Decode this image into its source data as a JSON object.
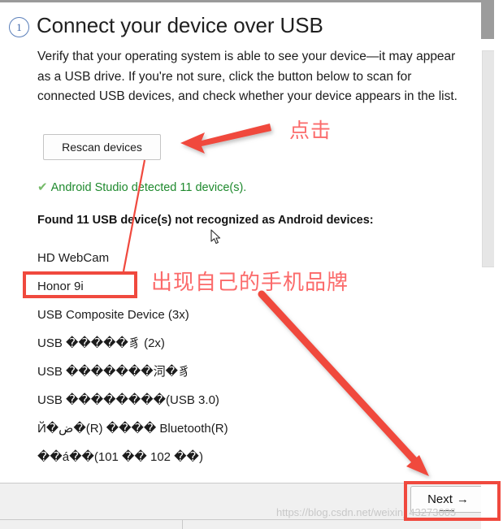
{
  "window": {
    "scrollbar_present": true
  },
  "header": {
    "step_number": "1",
    "title": "Connect your device over USB"
  },
  "body": {
    "description": "Verify that your operating system is able to see your device—it may appear as a USB drive. If you're not sure, click the button below to scan for connected USB devices, and check whether your device appears in the list."
  },
  "actions": {
    "rescan_label": "Rescan devices",
    "next_label": "Next",
    "next_arrow": "→"
  },
  "status": {
    "check_icon": "✔",
    "detected_message": "Android Studio detected 11 device(s).",
    "detected_color": "#1f8a2e",
    "found_heading": "Found 11 USB device(s) not recognized as Android devices:"
  },
  "devices": [
    {
      "label": "HD WebCam"
    },
    {
      "label": "Honor 9i"
    },
    {
      "label": "USB Composite Device (3x)"
    },
    {
      "label": "USB �����豸 (2x)"
    },
    {
      "label": "USB �������泀�豸"
    },
    {
      "label": "USB ��������(USB 3.0)"
    },
    {
      "label": "Й�ض�(R) ���� Bluetooth(R)"
    },
    {
      "label": "��á��(101 �� 102 ��)"
    }
  ],
  "annotations": {
    "click_label": "点击",
    "brand_label": "出现自己的手机品牌",
    "accent_color": "#f0493e",
    "label_color": "#fb6a6a"
  },
  "watermark": {
    "text": "https://blog.csdn.net/weixin_43273005"
  }
}
